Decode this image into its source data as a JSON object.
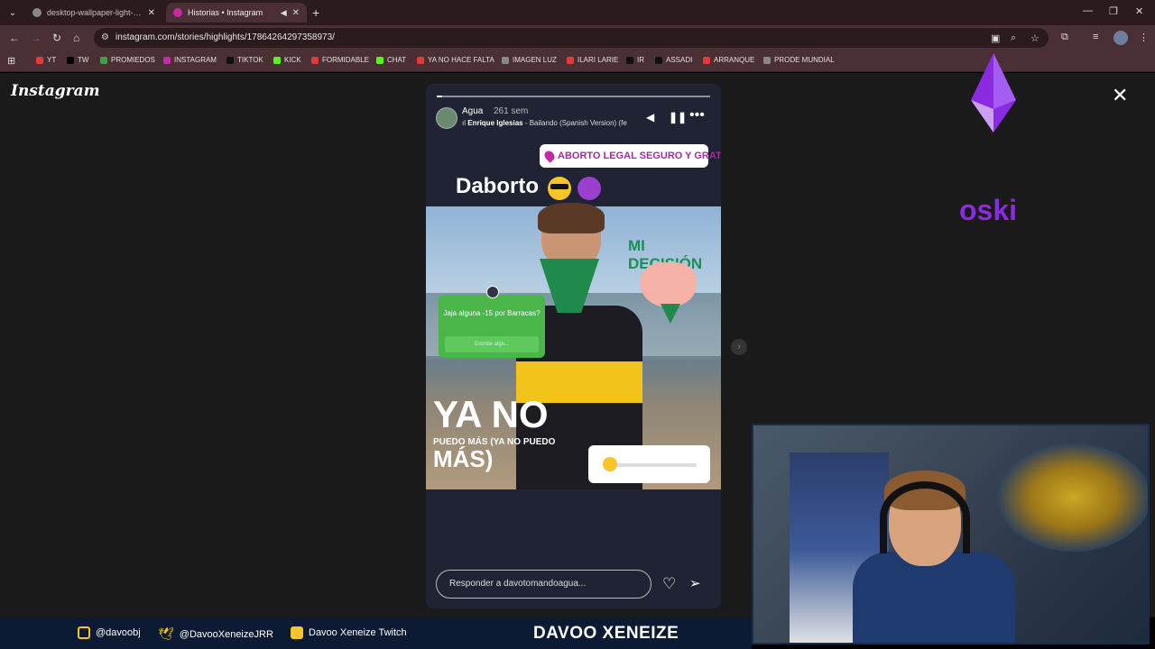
{
  "browser": {
    "tabs": [
      {
        "title": "desktop-wallpaper-light-yellow",
        "active": false
      },
      {
        "title": "Historias • Instagram",
        "active": true
      }
    ],
    "url": "instagram.com/stories/highlights/17864264297358973/"
  },
  "bookmarks": [
    {
      "label": "YT",
      "color": "#e53935"
    },
    {
      "label": "TW",
      "color": "#000000"
    },
    {
      "label": "PROMIEDOS",
      "color": "#43a047"
    },
    {
      "label": "INSTAGRAM",
      "color": "#c32aa3"
    },
    {
      "label": "TIKTOK",
      "color": "#111111"
    },
    {
      "label": "KICK",
      "color": "#53fc18"
    },
    {
      "label": "FORMIDABLE",
      "color": "#e53935"
    },
    {
      "label": "CHAT",
      "color": "#53fc18"
    },
    {
      "label": "YA NO HACE FALTA",
      "color": "#e53935"
    },
    {
      "label": "IMAGEN LUZ",
      "color": "#888888"
    },
    {
      "label": "ILARI LARIE",
      "color": "#e53935"
    },
    {
      "label": "IR",
      "color": "#111111"
    },
    {
      "label": "ASSADI",
      "color": "#111111"
    },
    {
      "label": "ARRANQUE",
      "color": "#e53935"
    },
    {
      "label": "PRODE MUNDIAL",
      "color": "#888888"
    }
  ],
  "instagram": {
    "logo": "Instagram",
    "story": {
      "username": "Agua",
      "time": "261 sem",
      "song_artist": "Enrique Iglesias",
      "song_title": " - Bailando (Spanish Version) (fe",
      "progress": 0.02,
      "location_sticker": "ABORTO LEGAL SEGURO Y GRATUITO",
      "caption": "Daborto",
      "overlay_text": "MI DECISIÓN",
      "question_sticker": "Jaja alguna -15 por Barracas?",
      "question_placeholder": "Escribe algo...",
      "big_text_1": "YA NO",
      "big_text_2": "PUEDO MÁS (YA NO PUEDO",
      "big_text_3": "MÁS)",
      "reply_placeholder": "Responder a davotomandoagua..."
    }
  },
  "overlay": {
    "brand_name": "oski",
    "brand_color": "#8a2be2",
    "socials": [
      {
        "label": "@davoobj",
        "icon": "instagram-icon",
        "color": "#f7c52b"
      },
      {
        "label": "@DavooXeneizeJRR",
        "icon": "twitter-icon",
        "color": "#f7c52b"
      },
      {
        "label": "Davoo Xeneize Twitch",
        "icon": "youtube-icon",
        "color": "#f7c52b"
      }
    ],
    "footer_brand": "DAVOO XENEIZE"
  }
}
